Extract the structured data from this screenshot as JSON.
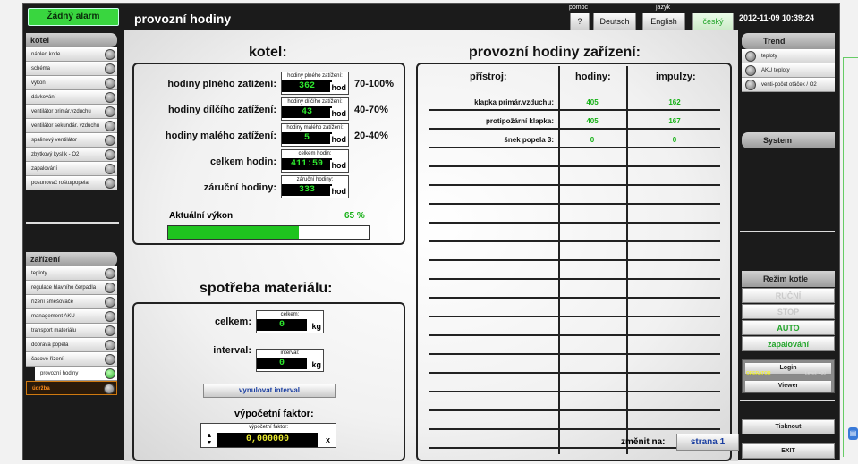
{
  "header": {
    "alarm": "Žádný alarm",
    "title": "provozní hodiny",
    "help_label": "pomoc",
    "help_button": "?",
    "lang_label": "jazyk",
    "languages": [
      "Deutsch",
      "English",
      "český"
    ],
    "datetime": "2012-11-09 10:39:24"
  },
  "left_top": {
    "header": "kotel",
    "items": [
      "náhled kotle",
      "schéma",
      "výkon",
      "dávkování",
      "ventilátor primár.vzduchu",
      "ventilátor sekundár. vzduchu",
      "spalinový ventilátor",
      "zbytkový kyslík - O2",
      "zapalování",
      "posunovač roštu/popela"
    ]
  },
  "left_bottom": {
    "header": "zařízení",
    "items": [
      "teploty",
      "regulace hlavního čerpadla",
      "řízení směšovače",
      "management AKU",
      "transport materiálu",
      "doprava popela",
      "časové řízení",
      "provozní hodiny",
      "údržba"
    ]
  },
  "kotel": {
    "title": "kotel:",
    "rows": [
      {
        "label": "hodiny plného zatížení:",
        "caption": "hodiny plného zatížení:",
        "value": "362",
        "unit": "hod",
        "range": "70-100%"
      },
      {
        "label": "hodiny dílčího zatížení:",
        "caption": "hodiny dílčího zatížení:",
        "value": "43",
        "unit": "hod",
        "range": "40-70%"
      },
      {
        "label": "hodiny malého zatížení:",
        "caption": "hodiny malého zatížení:",
        "value": "5",
        "unit": "hod",
        "range": "20-40%"
      },
      {
        "label": "celkem hodin:",
        "caption": "celkem hodin:",
        "value": "411:59",
        "unit": "hod",
        "range": ""
      },
      {
        "label": "záruční hodiny:",
        "caption": "záruční hodiny:",
        "value": "333",
        "unit": "hod",
        "range": ""
      }
    ],
    "power_label": "Aktuální výkon",
    "power_value": "65 %",
    "power_fraction": 0.65
  },
  "material": {
    "title": "spotřeba materiálu:",
    "total_label": "celkem:",
    "total_caption": "celkem:",
    "total_value": "0",
    "interval_label": "interval:",
    "interval_caption": "interval:",
    "interval_value": "0",
    "unit": "kg",
    "reset_button": "vynulovat interval",
    "factor_title": "výpočetní faktor:",
    "factor_caption": "výpočetní faktor:",
    "factor_value": "0,000000",
    "factor_close": "x"
  },
  "devices": {
    "title": "provozní hodiny zařízení:",
    "col_device": "přístroj:",
    "col_hours": "hodiny:",
    "col_pulses": "impulzy:",
    "rows": [
      {
        "name": "klapka primár.vzduchu:",
        "hours": "405",
        "pulses": "162"
      },
      {
        "name": "protipožární klapka:",
        "hours": "405",
        "pulses": "167"
      },
      {
        "name": "šnek popela 3:",
        "hours": "0",
        "pulses": "0"
      }
    ],
    "change_label": "změnit na:",
    "page_button": "strana 1"
  },
  "right": {
    "trend_header": "Trend",
    "trend_items": [
      "teploty",
      "AKU teploty",
      "venti-počet otáček / O2"
    ],
    "system_header": "System",
    "mode_header": "Režim kotle",
    "modes": [
      "RUČNÍ",
      "STOP",
      "AUTO",
      "zapalování"
    ],
    "login": "Login",
    "user": "OPERATOR",
    "level": "Level: 400",
    "viewer": "Viewer",
    "print": "Tisknout",
    "exit": "EXIT"
  },
  "colors": {
    "green": "#2ee82e",
    "accent_text": "#14b014",
    "bar": "#1fc41f",
    "orange": "#ff8c1a"
  }
}
